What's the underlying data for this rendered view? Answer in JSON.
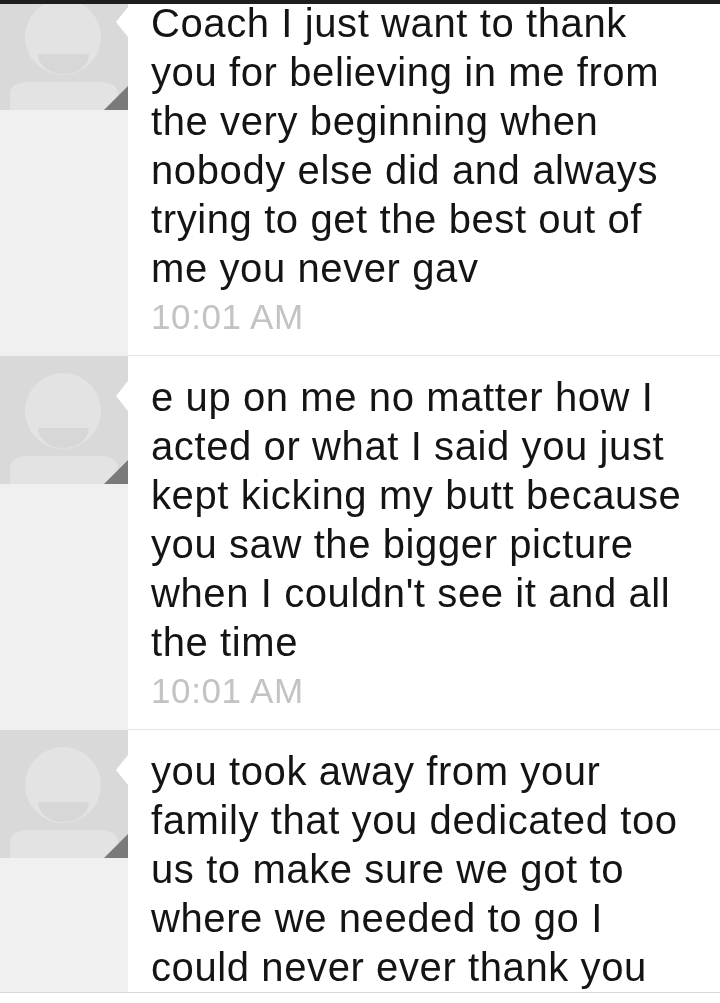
{
  "messages": [
    {
      "text": "Coach I just want to thank you for believing in me from the very beginning when nobody else did and always trying to get the best out of me you never gav",
      "time": "10:01 AM"
    },
    {
      "text": "e up on me no matter how I acted or what I said you just kept kicking my butt because you saw the bigger picture when I couldn't see it and all the time",
      "time": "10:01 AM"
    },
    {
      "text": "you took away from your family that you dedicated too us to make sure we got to where we needed to go I could never ever thank you"
    }
  ]
}
